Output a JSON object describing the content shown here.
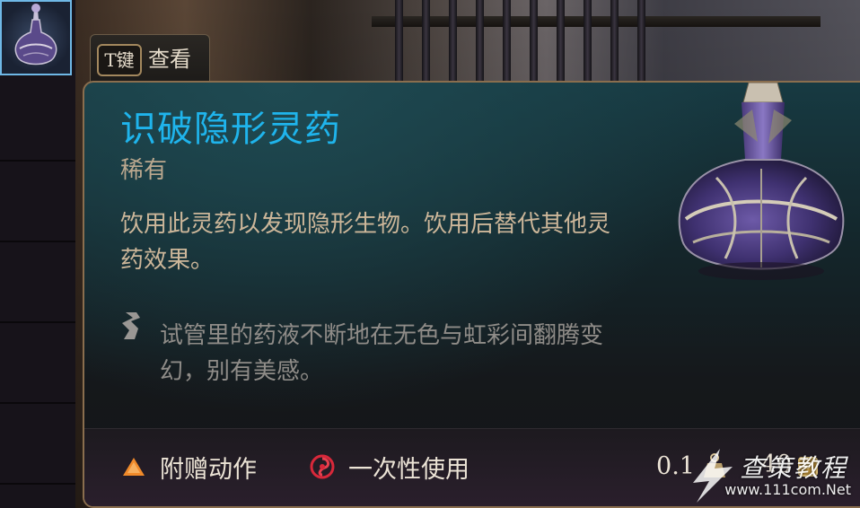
{
  "hint": {
    "key_label": "T键",
    "action_label": "查看"
  },
  "item": {
    "name": "识破隐形灵药",
    "rarity": "稀有",
    "description": "饮用此灵药以发现隐形生物。饮用后替代其他灵药效果。",
    "flavor_text": "试管里的药液不断地在无色与虹彩间翻腾变幻，别有美感。",
    "icon": "potion-bottle-icon",
    "name_color": "#1fb4ec"
  },
  "footer": {
    "action_type": "附赠动作",
    "usage": "一次性使用",
    "weight": "0.1",
    "price": "40"
  },
  "watermark": {
    "brand": "查策教程",
    "site": "www.111com.Net"
  }
}
